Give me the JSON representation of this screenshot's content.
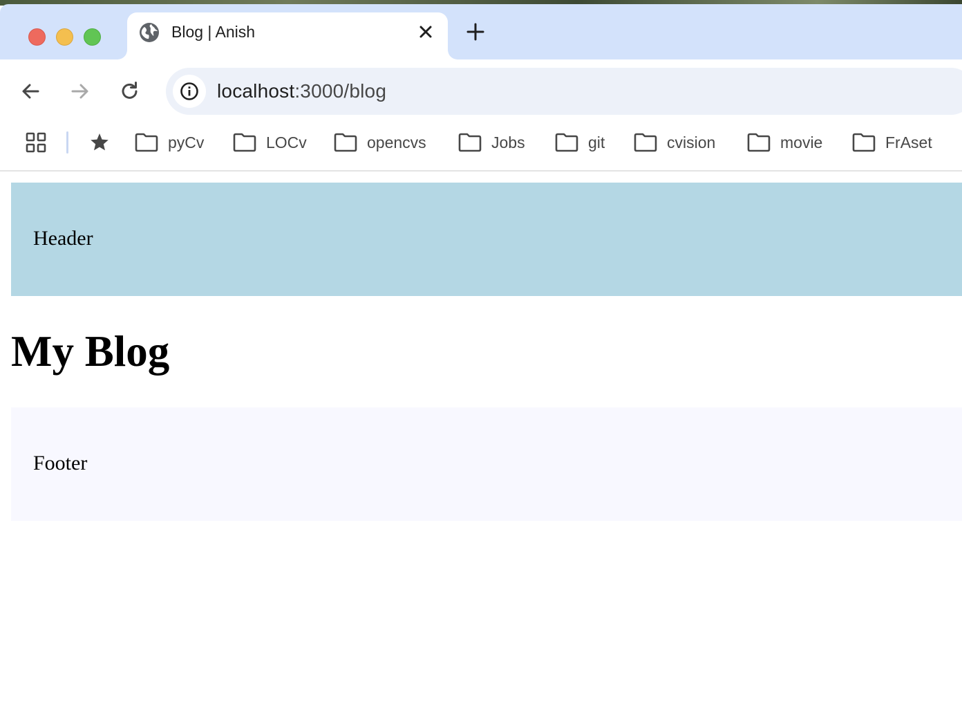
{
  "browser": {
    "tab": {
      "title": "Blog | Anish"
    },
    "address": {
      "host": "localhost",
      "path": ":3000/blog"
    },
    "bookmarks": [
      "pyCv",
      "LOCv",
      "opencvs",
      "Jobs",
      "git",
      "cvision",
      "movie",
      "FrAset"
    ]
  },
  "page": {
    "header_text": "Header",
    "title": "My Blog",
    "footer_text": "Footer"
  },
  "colors": {
    "tab_strip": "#d3e2fb",
    "header_bg": "#b4d7e4",
    "footer_bg": "#f8f8ff"
  }
}
